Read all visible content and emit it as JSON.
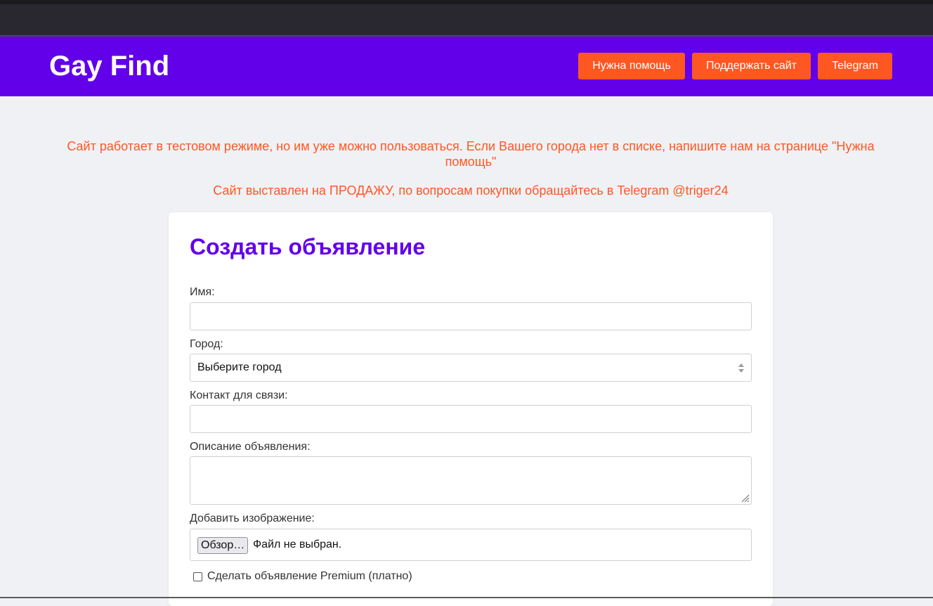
{
  "header": {
    "logo": "Gay Find",
    "nav": {
      "help": "Нужна помощь",
      "support": "Поддержать сайт",
      "telegram": "Telegram"
    }
  },
  "notices": {
    "test_mode": "Сайт работает в тестовом режиме, но им уже можно пользоваться. Если Вашего города нет в списке, напишите нам на странице \"Нужна помощь\"",
    "for_sale": "Сайт выставлен на ПРОДАЖУ, по вопросам покупки обращайтесь в Telegram @triger24"
  },
  "form": {
    "title": "Создать объявление",
    "name_label": "Имя:",
    "name_value": "",
    "city_label": "Город:",
    "city_selected": "Выберите город",
    "contact_label": "Контакт для связи:",
    "contact_value": "",
    "description_label": "Описание объявления:",
    "description_value": "",
    "image_label": "Добавить изображение:",
    "file_button": "Обзор…",
    "file_status": "Файл не выбран.",
    "premium_label": "Сделать объявление Premium (платно)"
  },
  "colors": {
    "brand": "#6200ea",
    "accent": "#ff5722",
    "background": "#f0f1f5"
  }
}
